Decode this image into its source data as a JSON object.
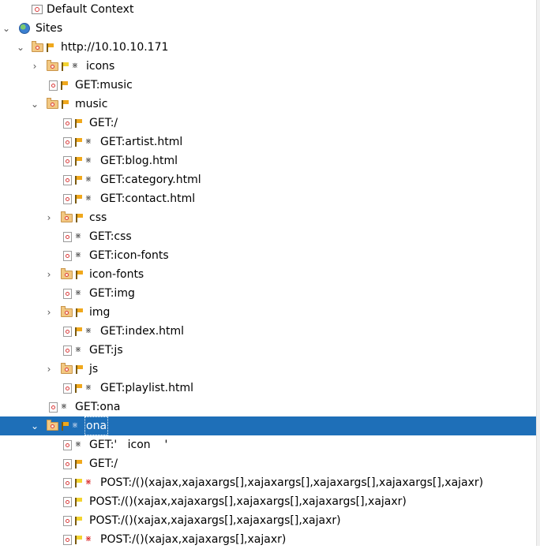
{
  "tree": {
    "default_context": {
      "label": "Default Context"
    },
    "sites": {
      "label": "Sites"
    },
    "host": {
      "label": "http://10.10.10.171"
    },
    "host_items": {
      "icons": {
        "label": "icons"
      },
      "get_music": {
        "label": "GET:music"
      },
      "music": {
        "label": "music"
      },
      "get_ona": {
        "label": "GET:ona"
      },
      "ona": {
        "label": "ona"
      }
    },
    "music_items": [
      {
        "label": "GET:/"
      },
      {
        "label": "GET:artist.html"
      },
      {
        "label": "GET:blog.html"
      },
      {
        "label": "GET:category.html"
      },
      {
        "label": "GET:contact.html"
      },
      {
        "label": "css"
      },
      {
        "label": "GET:css"
      },
      {
        "label": "GET:icon-fonts"
      },
      {
        "label": "icon-fonts"
      },
      {
        "label": "GET:img"
      },
      {
        "label": "img"
      },
      {
        "label": "GET:index.html"
      },
      {
        "label": "GET:js"
      },
      {
        "label": "js"
      },
      {
        "label": "GET:playlist.html"
      }
    ],
    "ona_items": [
      {
        "label": "GET:'   icon    '"
      },
      {
        "label": "GET:/"
      },
      {
        "label": "POST:/()(xajax,xajaxargs[],xajaxargs[],xajaxargs[],xajaxargs[],xajaxr)"
      },
      {
        "label": "POST:/()(xajax,xajaxargs[],xajaxargs[],xajaxargs[],xajaxr)"
      },
      {
        "label": "POST:/()(xajax,xajaxargs[],xajaxargs[],xajaxr)"
      },
      {
        "label": "POST:/()(xajax,xajaxargs[],xajaxr)"
      }
    ],
    "selected": "ona"
  }
}
